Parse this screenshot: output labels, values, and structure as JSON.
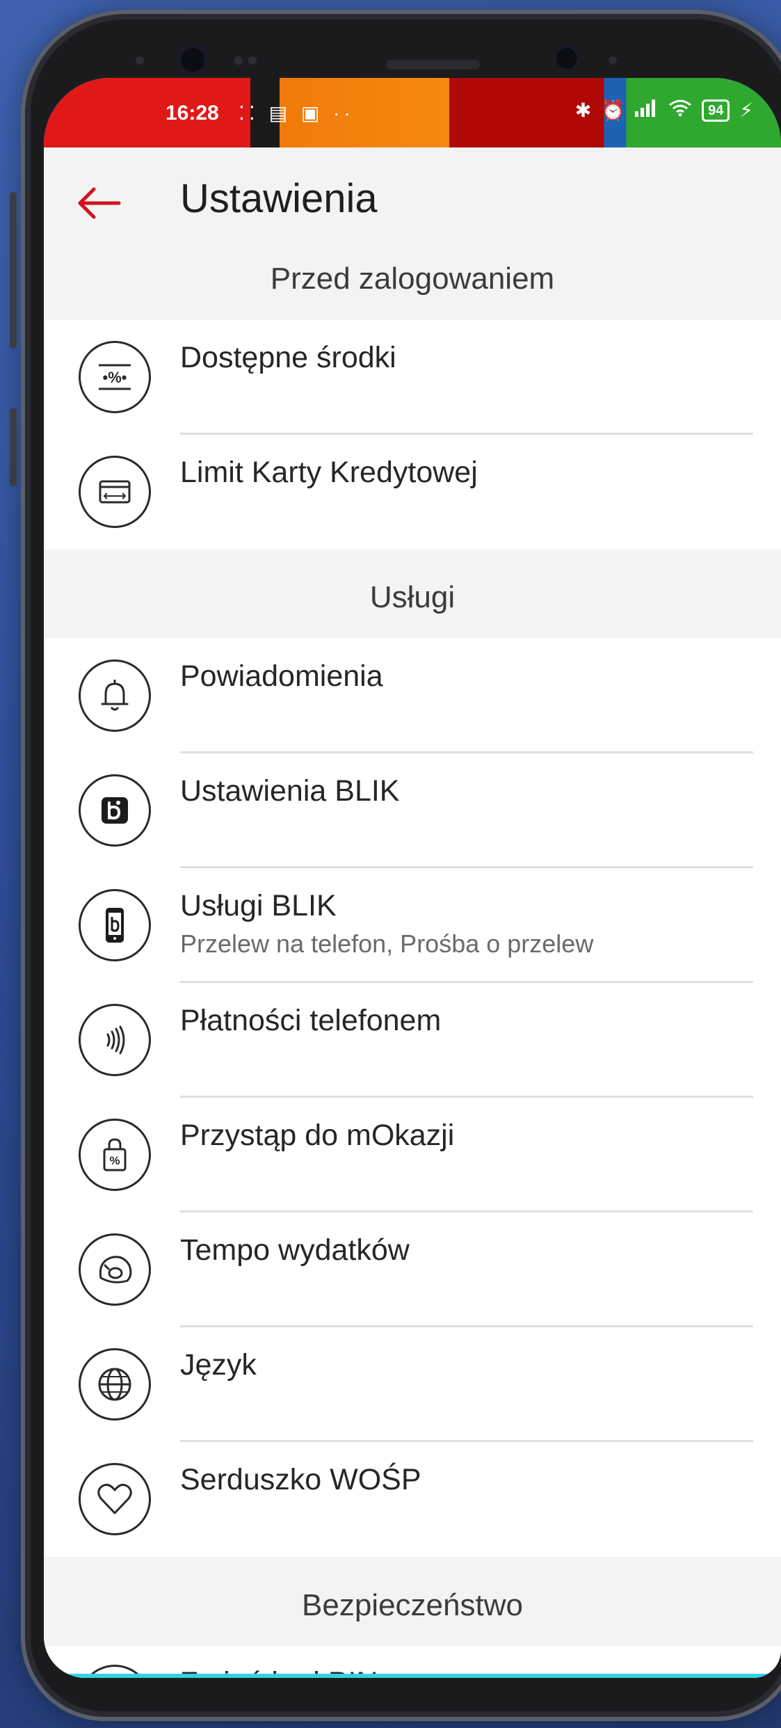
{
  "status_bar": {
    "time": "16:28",
    "left_icons": "⁚⁚ ▤ ▣ ··",
    "battery": "94"
  },
  "header": {
    "title": "Ustawienia"
  },
  "sections": [
    {
      "title": "Przed zalogowaniem",
      "items": [
        {
          "label": "Dostępne środki",
          "icon": "percent-balance-icon"
        },
        {
          "label": "Limit Karty Kredytowej",
          "icon": "credit-card-icon"
        }
      ]
    },
    {
      "title": "Usługi",
      "items": [
        {
          "label": "Powiadomienia",
          "icon": "bell-icon"
        },
        {
          "label": "Ustawienia BLIK",
          "icon": "blik-icon"
        },
        {
          "label": "Usługi BLIK",
          "sublabel": "Przelew na telefon, Prośba o przelew",
          "icon": "blik-phone-icon"
        },
        {
          "label": "Płatności telefonem",
          "icon": "contactless-icon"
        },
        {
          "label": "Przystąp do mOkazji",
          "icon": "shopping-bag-percent-icon"
        },
        {
          "label": "Tempo wydatków",
          "icon": "speedometer-icon"
        },
        {
          "label": "Język",
          "icon": "globe-icon"
        },
        {
          "label": "Serduszko WOŚP",
          "icon": "heart-icon"
        }
      ]
    },
    {
      "title": "Bezpieczeństwo",
      "items": [
        {
          "label": "Zmień kod PIN",
          "icon": "lock-icon"
        }
      ]
    }
  ]
}
